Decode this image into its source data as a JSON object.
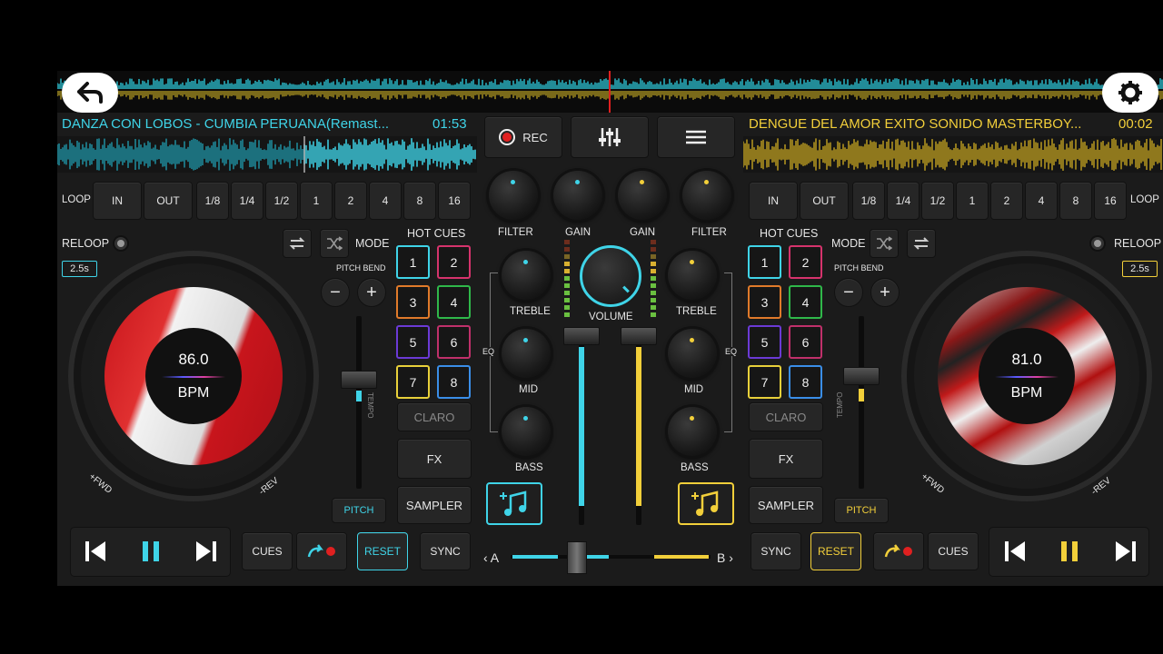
{
  "colors": {
    "deck_a": "#3fd4e8",
    "deck_b": "#f2cf3a",
    "rec": "#e02020",
    "background": "#1b1b1b"
  },
  "icons": {
    "back": "back-arrow-icon",
    "settings": "gear-icon",
    "mixer": "sliders-icon",
    "menu": "hamburger-menu-icon",
    "shuffle": "shuffle-icon",
    "repeat": "repeat-icon",
    "music": "music-note-add-icon"
  },
  "deck_a": {
    "track_title": "DANZA CON LOBOS - CUMBIA PERUANA(Remast...",
    "time": "01:53",
    "loop_label": "LOOP",
    "loop_buttons": [
      "IN",
      "OUT",
      "1/8",
      "1/4",
      "1/2",
      "1",
      "2",
      "4",
      "8",
      "16"
    ],
    "reloop": "RELOOP",
    "reloop_time": "2.5s",
    "mode": "MODE",
    "pitch_bend": "PITCH BEND",
    "tempo": "TEMPO",
    "pitch": "PITCH",
    "hot_cues_title": "HOT CUES",
    "hot_cues": [
      "1",
      "2",
      "3",
      "4",
      "5",
      "6",
      "7",
      "8"
    ],
    "claro": "CLARO",
    "fx": "FX",
    "sampler": "SAMPLER",
    "bpm": "86.0",
    "bpm_label": "BPM",
    "fwd": "+FWD",
    "rev": "-REV",
    "cues": "CUES",
    "reset": "RESET",
    "sync": "SYNC"
  },
  "deck_b": {
    "track_title": "DENGUE DEL AMOR EXITO SONIDO MASTERBOY...",
    "time": "00:02",
    "loop_label": "LOOP",
    "loop_buttons": [
      "IN",
      "OUT",
      "1/8",
      "1/4",
      "1/2",
      "1",
      "2",
      "4",
      "8",
      "16"
    ],
    "reloop": "RELOOP",
    "reloop_time": "2.5s",
    "mode": "MODE",
    "pitch_bend": "PITCH BEND",
    "tempo": "TEMPO",
    "pitch": "PITCH",
    "hot_cues_title": "HOT CUES",
    "hot_cues": [
      "1",
      "2",
      "3",
      "4",
      "5",
      "6",
      "7",
      "8"
    ],
    "claro": "CLARO",
    "fx": "FX",
    "sampler": "SAMPLER",
    "bpm": "81.0",
    "bpm_label": "BPM",
    "fwd": "+FWD",
    "rev": "-REV",
    "cues": "CUES",
    "reset": "RESET",
    "sync": "SYNC"
  },
  "mixer": {
    "rec": "REC",
    "filter": "FILTER",
    "gain": "GAIN",
    "treble": "TREBLE",
    "mid": "MID",
    "bass": "BASS",
    "eq": "EQ",
    "volume": "VOLUME",
    "crossfader_a": "A",
    "crossfader_b": "B",
    "channel_a_level": 0.68,
    "channel_b_level": 0.68,
    "crossfader_position": 0.28
  }
}
